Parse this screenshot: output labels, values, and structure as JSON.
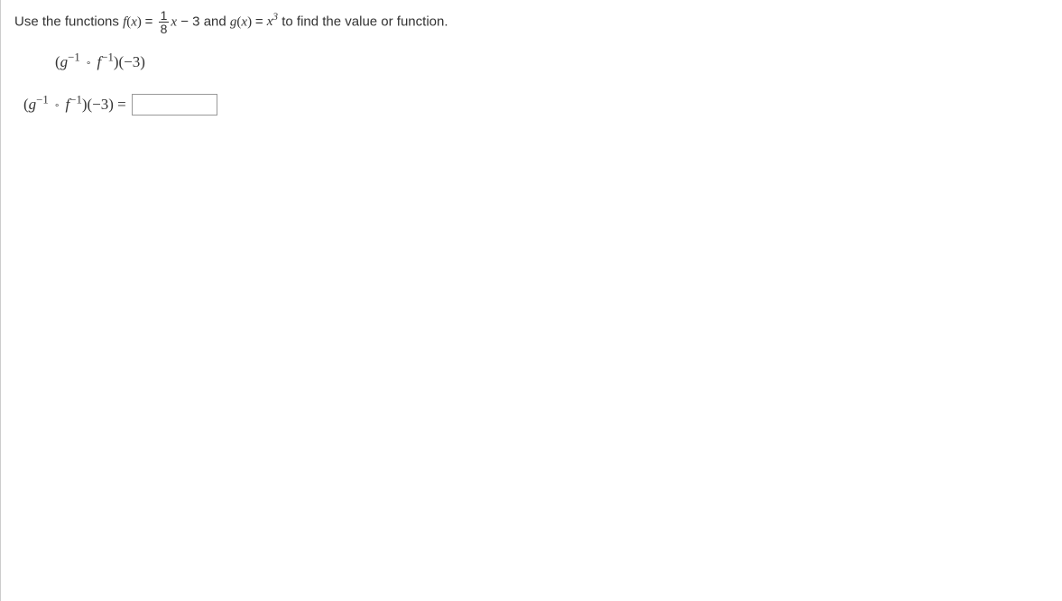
{
  "prompt": {
    "text1": "Use the functions  ",
    "fx": "f",
    "openParen1": "(",
    "x1": "x",
    "closeParen1": ")",
    "equals1": " = ",
    "frac_num": "1",
    "frac_den": "8",
    "x2": "x",
    "minus3_1": " − 3",
    "and_text": "  and  ",
    "gx": "g",
    "openParen2": "(",
    "x3": "x",
    "closeParen2": ")",
    "equals2": " = ",
    "x4": "x",
    "cubed": "3",
    "text2": "  to find the value or function."
  },
  "expression": {
    "open": "(",
    "g": "g",
    "neg1_a": "−1",
    "ring": "∘",
    "f": "f",
    "neg1_b": "−1",
    "close": ")(−3)"
  },
  "answer": {
    "open": "(",
    "g": "g",
    "neg1_a": "−1",
    "ring": "∘",
    "f": "f",
    "neg1_b": "−1",
    "close": ")(−3) ="
  }
}
